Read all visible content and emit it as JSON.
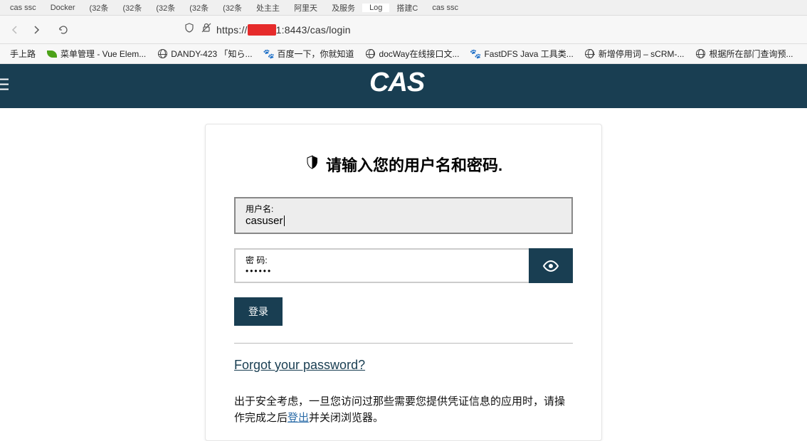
{
  "browser": {
    "tabs": [
      {
        "label": "cas ssc"
      },
      {
        "label": "Docker"
      },
      {
        "label": "(32条"
      },
      {
        "label": "(32条"
      },
      {
        "label": "(32条"
      },
      {
        "label": "(32条"
      },
      {
        "label": "(32条"
      },
      {
        "label": "处主主"
      },
      {
        "label": "阿里天"
      },
      {
        "label": "及服务"
      },
      {
        "label": "Log"
      },
      {
        "label": "搭建C"
      },
      {
        "label": "cas ssc"
      }
    ],
    "url_prefix": "https://",
    "url_redacted": "xxxxx",
    "url_suffix": "1:8443/cas/login",
    "bookmarks": [
      {
        "label": "手上路",
        "type": "none"
      },
      {
        "label": "菜单管理 - Vue Elem...",
        "type": "leaf"
      },
      {
        "label": "DANDY-423 「知ら...",
        "type": "globe"
      },
      {
        "label": "百度一下，你就知道",
        "type": "paw"
      },
      {
        "label": "docWay在线接口文...",
        "type": "globe"
      },
      {
        "label": "FastDFS Java 工具类...",
        "type": "paw"
      },
      {
        "label": "新增停用词 – sCRM-...",
        "type": "globe"
      },
      {
        "label": "根据所在部门查询预...",
        "type": "globe"
      }
    ]
  },
  "cas": {
    "logo": "CAS",
    "heading": "请输入您的用户名和密码.",
    "username_label": "用户名:",
    "username_value": "casuser",
    "password_label": "密  码:",
    "password_value": "••••••",
    "login_button": "登录",
    "forgot_password": "Forgot your password?",
    "security_text_1": "出于安全考虑，一旦您访问过那些需要您提供凭证信息的应用时，请操作完成之后",
    "security_link": "登出",
    "security_text_2": "并关闭浏览器。"
  }
}
